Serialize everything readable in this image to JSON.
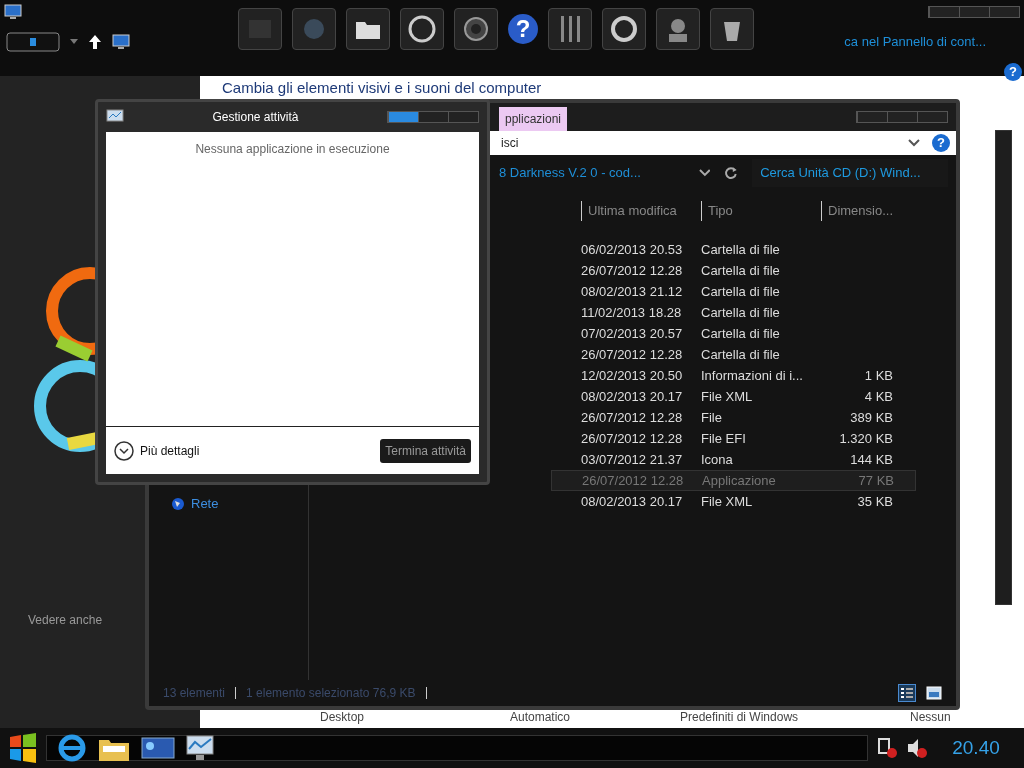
{
  "control_panel": {
    "search_text": "ca nel Pannello di cont...",
    "help_glyph": "?",
    "heading": "Cambia gli elementi visivi e i suoni del computer",
    "see_also": "Vedere anche",
    "bottom_labels": [
      "Desktop",
      "Automatico",
      "Predefiniti di Windows",
      "Nessun"
    ]
  },
  "dock": {
    "help_glyph": "?"
  },
  "explorer": {
    "tab": "pplicazioni",
    "address": "isci",
    "breadcrumb": "8 Darkness V.2 0 - cod...",
    "search_placeholder": "Cerca Unità CD (D:) Wind...",
    "help_glyph": "?",
    "nav_items": [
      {
        "label": "Rete"
      }
    ],
    "columns": [
      "Ultima modifica",
      "Tipo",
      "Dimensio..."
    ],
    "rows": [
      {
        "modified": "06/02/2013 20.53",
        "type": "Cartella di file",
        "size": "",
        "selected": false
      },
      {
        "modified": "26/07/2012 12.28",
        "type": "Cartella di file",
        "size": "",
        "selected": false
      },
      {
        "modified": "08/02/2013 21.12",
        "type": "Cartella di file",
        "size": "",
        "selected": false
      },
      {
        "modified": "11/02/2013 18.28",
        "type": "Cartella di file",
        "size": "",
        "selected": false
      },
      {
        "modified": "07/02/2013 20.57",
        "type": "Cartella di file",
        "size": "",
        "selected": false
      },
      {
        "modified": "26/07/2012 12.28",
        "type": "Cartella di file",
        "size": "",
        "selected": false
      },
      {
        "modified": "12/02/2013 20.50",
        "type": "Informazioni di i...",
        "size": "1 KB",
        "selected": false
      },
      {
        "modified": "08/02/2013 20.17",
        "type": "File XML",
        "size": "4 KB",
        "selected": false
      },
      {
        "modified": "26/07/2012 12.28",
        "type": "File",
        "size": "389 KB",
        "selected": false
      },
      {
        "modified": "26/07/2012 12.28",
        "type": "File EFI",
        "size": "1.320 KB",
        "selected": false
      },
      {
        "modified": "03/07/2012 21.37",
        "type": "Icona",
        "size": "144 KB",
        "selected": false
      },
      {
        "modified": "26/07/2012 12.28",
        "type": "Applicazione",
        "size": "77 KB",
        "selected": true
      },
      {
        "modified": "08/02/2013 20.17",
        "type": "File XML",
        "size": "35 KB",
        "selected": false
      }
    ],
    "status": [
      "13 elementi",
      "1 elemento selezionato 76,9 KB"
    ]
  },
  "task_manager": {
    "title": "Gestione attività",
    "empty_message": "Nessuna applicazione in esecuzione",
    "details": "Più dettagli",
    "end_task": "Termina attività"
  },
  "taskbar": {
    "clock": "20.40"
  }
}
